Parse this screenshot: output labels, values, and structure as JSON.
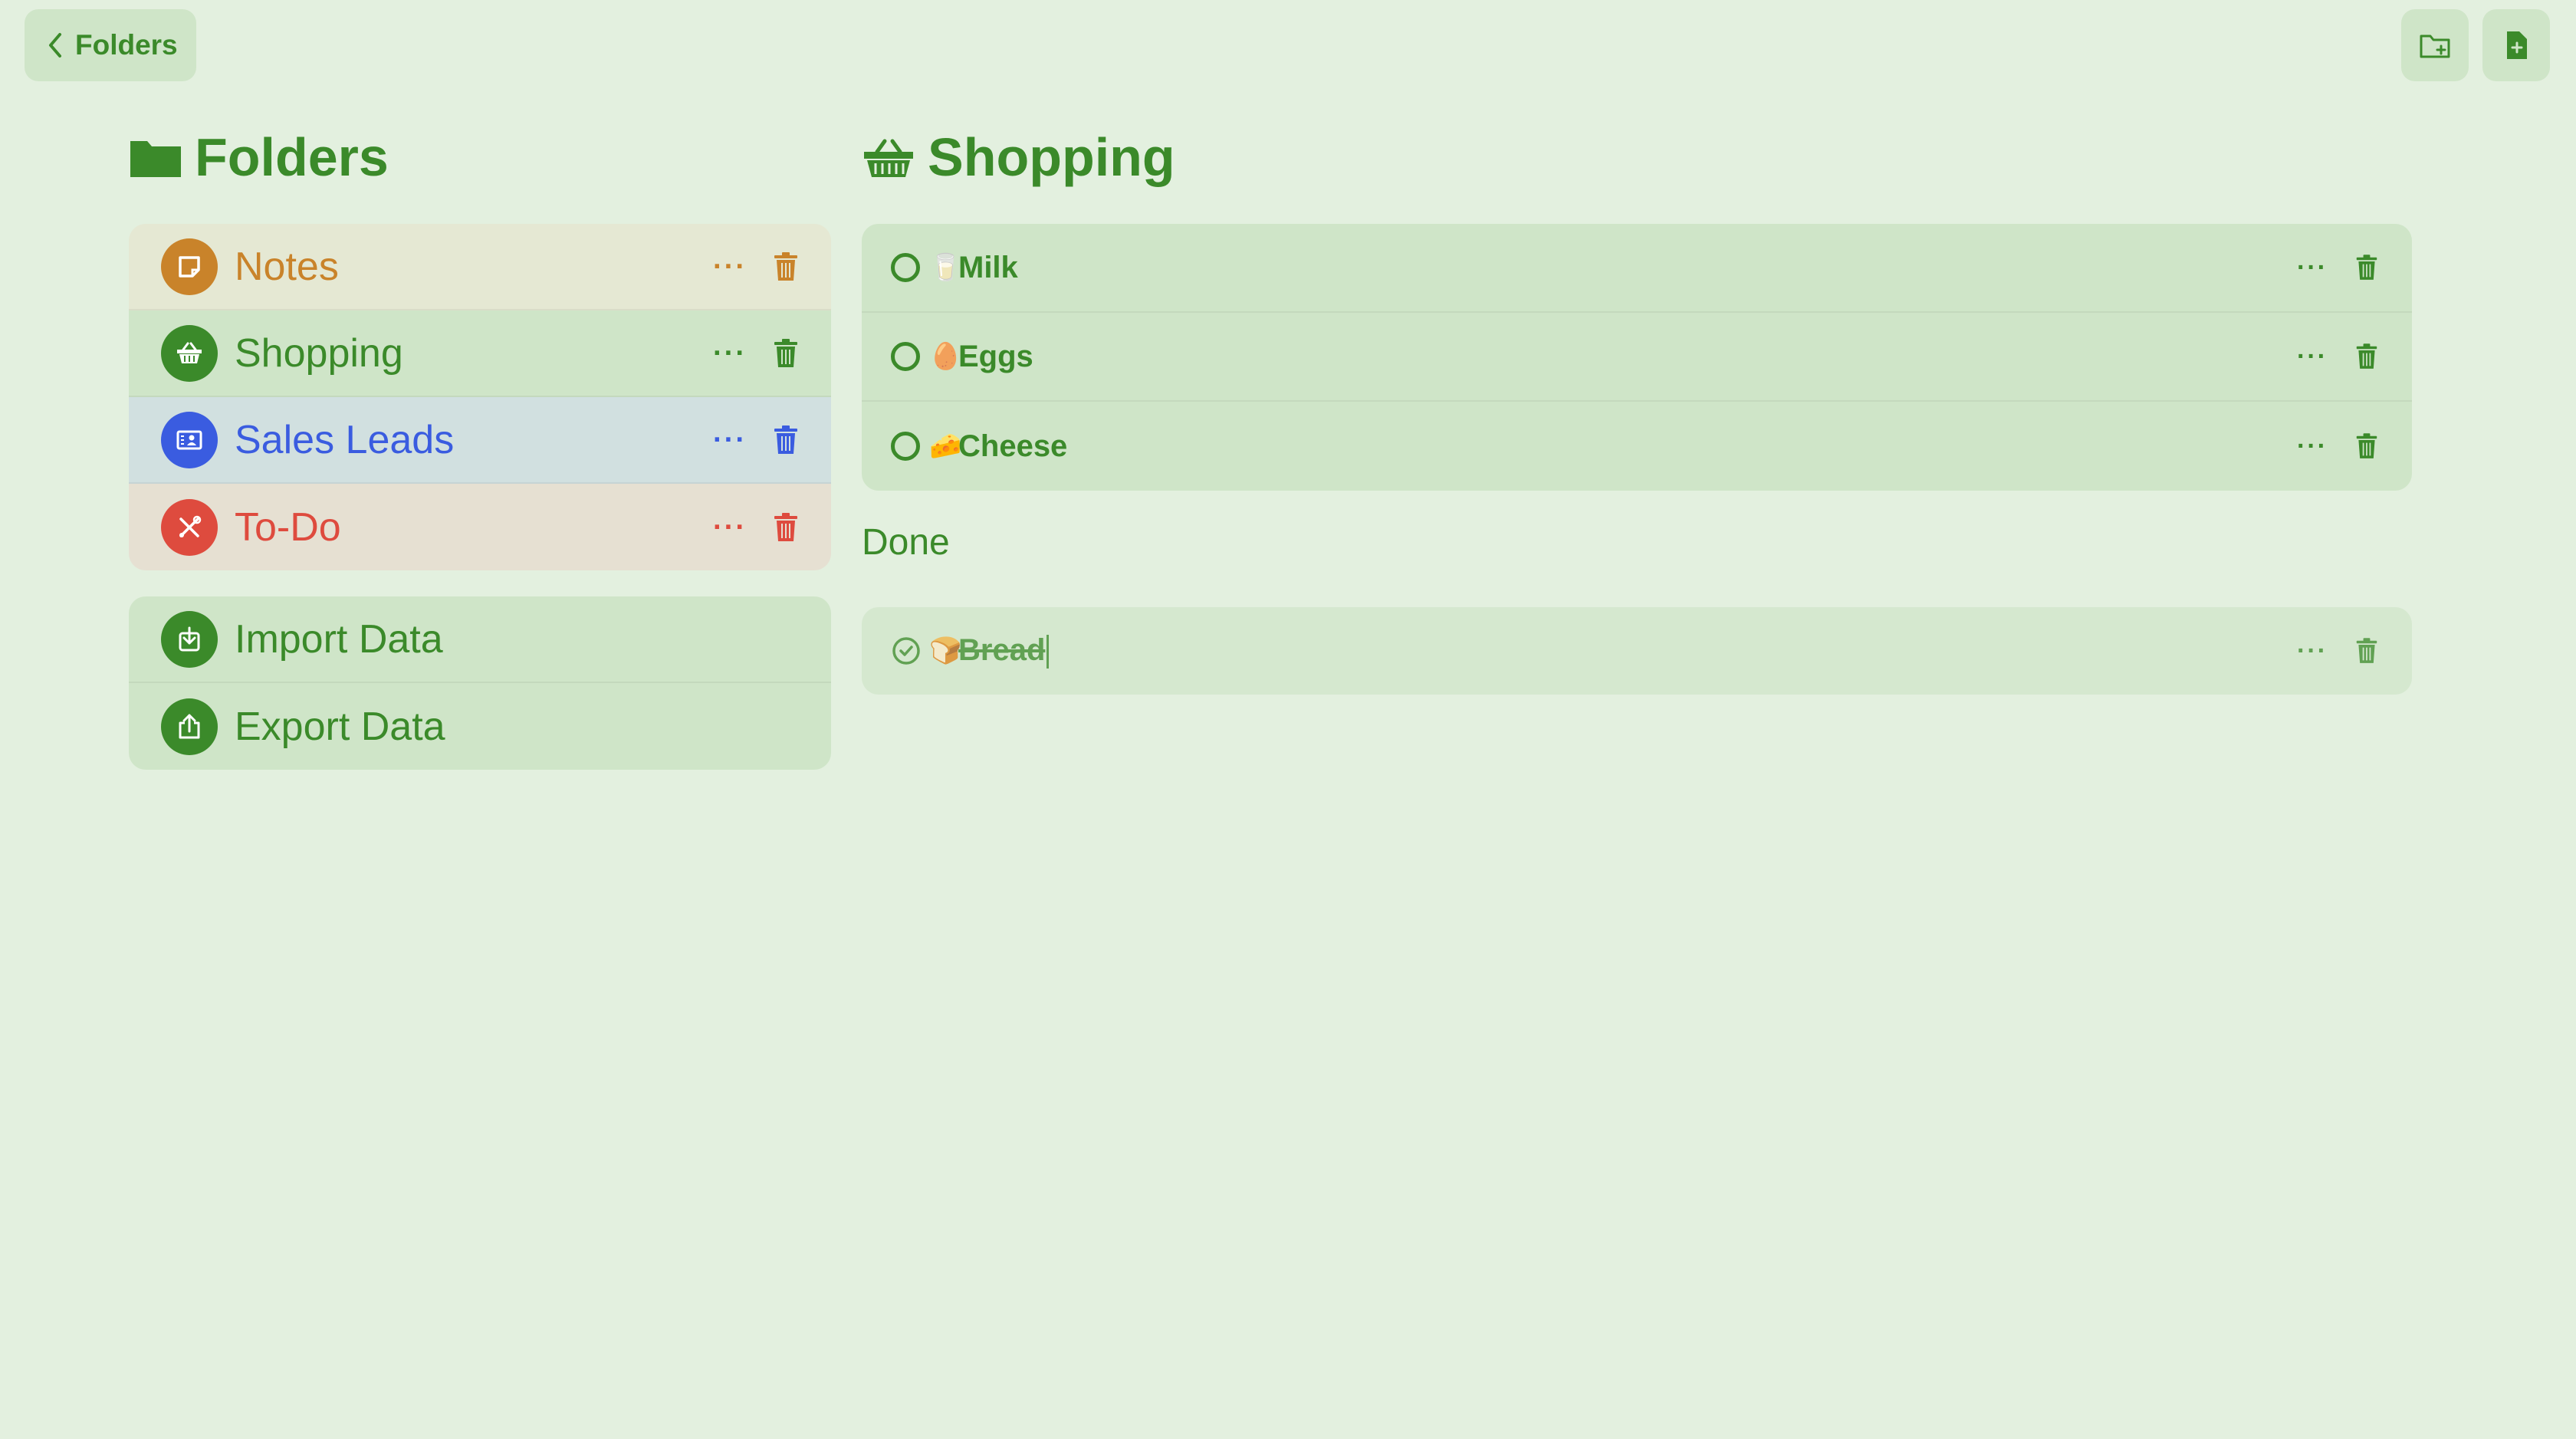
{
  "nav": {
    "back_label": "Folders"
  },
  "colors": {
    "background": "#e3f0df",
    "accent_green": "#3b8a2a",
    "notes_orange": "#c9832a",
    "sales_blue": "#3a5ce0",
    "todo_red": "#de4b3e"
  },
  "folders_panel": {
    "title": "Folders",
    "folders": [
      {
        "label": "Notes",
        "icon": "sticky-note-icon",
        "color": "#c9832a"
      },
      {
        "label": "Shopping",
        "icon": "basket-icon",
        "color": "#3b8a2a"
      },
      {
        "label": "Sales Leads",
        "icon": "contact-card-icon",
        "color": "#3a5ce0"
      },
      {
        "label": "To-Do",
        "icon": "tools-icon",
        "color": "#de4b3e"
      }
    ],
    "actions": [
      {
        "label": "Import Data",
        "icon": "import-icon"
      },
      {
        "label": "Export Data",
        "icon": "export-icon"
      }
    ],
    "more_label": "···"
  },
  "list_panel": {
    "title": "Shopping",
    "items": [
      {
        "emoji": "🥛",
        "label": "Milk"
      },
      {
        "emoji": "🥚",
        "label": "Eggs"
      },
      {
        "emoji": "🧀",
        "label": "Cheese"
      }
    ],
    "done_title": "Done",
    "done_items": [
      {
        "emoji": "🍞",
        "label": "Bread"
      }
    ]
  }
}
